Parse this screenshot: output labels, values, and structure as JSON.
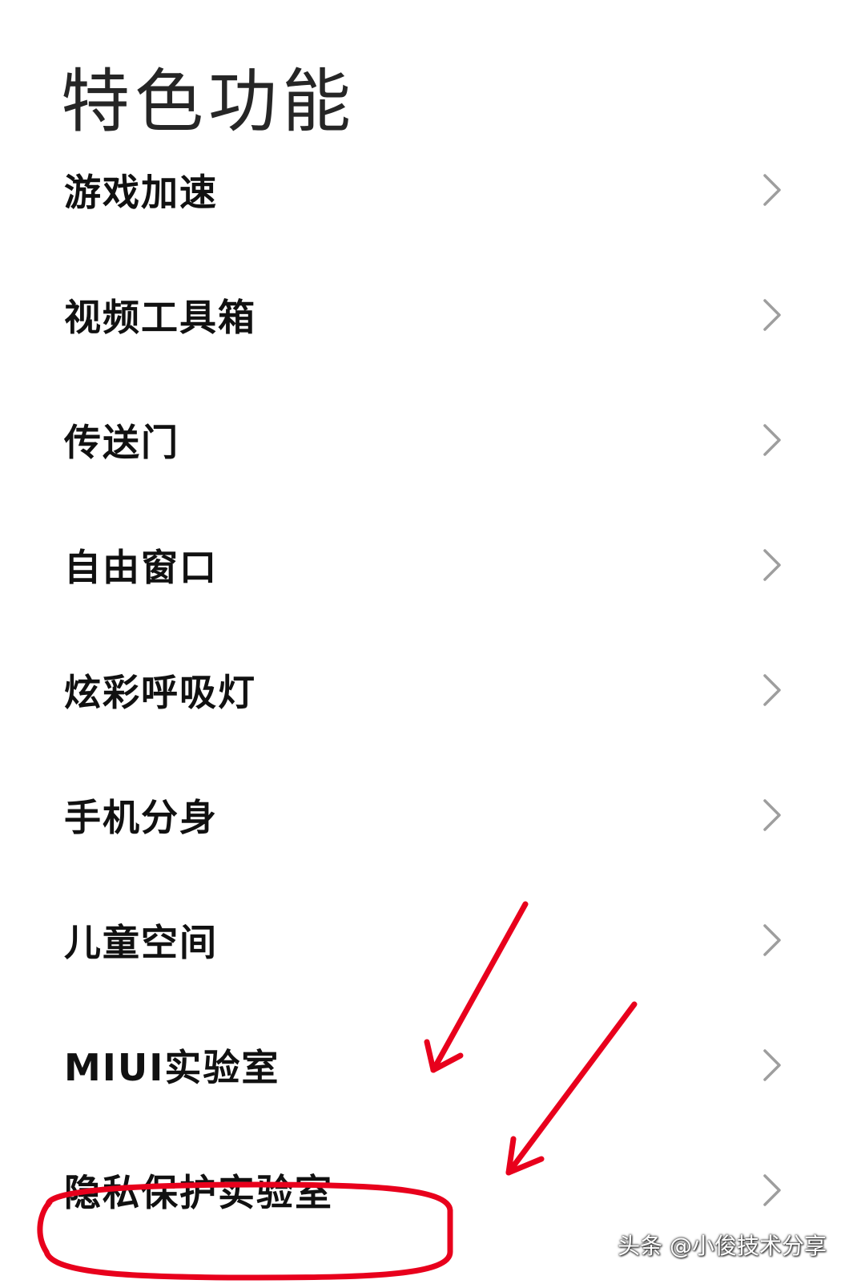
{
  "header": {
    "title": "特色功能"
  },
  "menu": {
    "items": [
      {
        "label": "游戏加速"
      },
      {
        "label": "视频工具箱"
      },
      {
        "label": "传送门"
      },
      {
        "label": "自由窗口"
      },
      {
        "label": "炫彩呼吸灯"
      },
      {
        "label": "手机分身"
      },
      {
        "label": "儿童空间"
      },
      {
        "label": "MIUI实验室"
      },
      {
        "label": "隐私保护实验室"
      }
    ]
  },
  "icons": {
    "chevron": "chevron-right-icon",
    "annotation_arrow": "red-arrow-icon",
    "annotation_circle": "red-circle-highlight"
  },
  "colors": {
    "background": "#ffffff",
    "title": "#262626",
    "label": "#111111",
    "chevron": "#9e9e9e",
    "annotation": "#e8001c"
  },
  "watermark": {
    "text": "头条 @小俊技术分享"
  }
}
